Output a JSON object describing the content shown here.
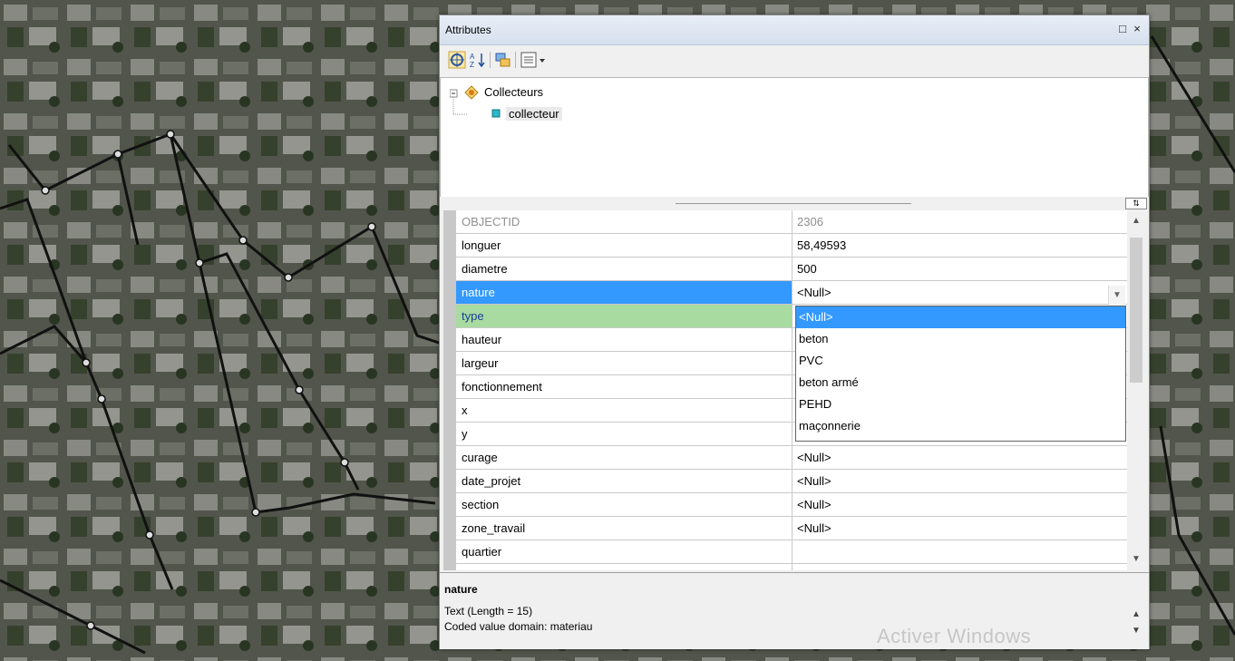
{
  "window": {
    "title": "Attributes",
    "restore_glyph": "□",
    "close_glyph": "×"
  },
  "toolbar": {
    "icons": [
      "identify-icon",
      "sort-ascending-icon",
      "select-features-icon",
      "options-icon",
      "dropdown-arrow-icon"
    ]
  },
  "tree": {
    "layer": "Collecteurs",
    "feature": "collecteur"
  },
  "attributes": [
    {
      "name": "OBJECTID",
      "value": "2306",
      "state": "readonly"
    },
    {
      "name": "longuer",
      "value": "58,49593",
      "state": "normal"
    },
    {
      "name": "diametre",
      "value": "500",
      "state": "normal"
    },
    {
      "name": "nature",
      "value": "<Null>",
      "state": "selected"
    },
    {
      "name": "type",
      "value": "",
      "state": "green"
    },
    {
      "name": "hauteur",
      "value": "",
      "state": "normal"
    },
    {
      "name": "largeur",
      "value": "",
      "state": "normal"
    },
    {
      "name": "fonctionnement",
      "value": "",
      "state": "normal"
    },
    {
      "name": "x",
      "value": "",
      "state": "normal"
    },
    {
      "name": "y",
      "value": "",
      "state": "normal"
    },
    {
      "name": "curage",
      "value": "<Null>",
      "state": "normal"
    },
    {
      "name": "date_projet",
      "value": "<Null>",
      "state": "normal"
    },
    {
      "name": "section",
      "value": "<Null>",
      "state": "normal"
    },
    {
      "name": "zone_travail",
      "value": "<Null>",
      "state": "normal"
    },
    {
      "name": "quartier",
      "value": "",
      "state": "normal"
    },
    {
      "name": "",
      "value": "",
      "state": "normal"
    }
  ],
  "dropdown": {
    "options": [
      "<Null>",
      "beton",
      "PVC",
      "beton armé",
      "PEHD",
      "maçonnerie"
    ],
    "selected_index": 0
  },
  "description": {
    "field_name": "nature",
    "line1": "Text (Length = 15)",
    "line2": "Coded value domain: materiau"
  },
  "watermark": "Activer Windows",
  "colors": {
    "selection": "#3399ff",
    "type_highlight": "#a8dba0"
  }
}
